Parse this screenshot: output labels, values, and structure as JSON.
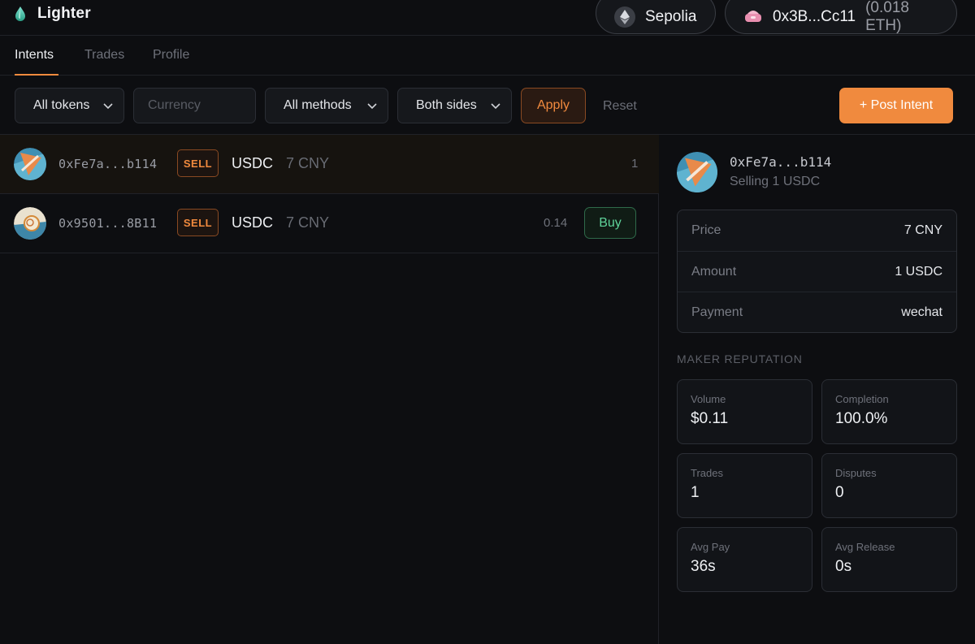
{
  "header": {
    "app_name": "Lighter",
    "network": "Sepolia",
    "wallet_address": "0x3B...Cc11",
    "wallet_balance": "(0.018 ETH)"
  },
  "tabs": [
    {
      "label": "Intents",
      "active": true
    },
    {
      "label": "Trades",
      "active": false
    },
    {
      "label": "Profile",
      "active": false
    }
  ],
  "filters": {
    "token_select": "All tokens",
    "currency_placeholder": "Currency",
    "method_select": "All methods",
    "side_select": "Both sides",
    "apply_label": "Apply",
    "reset_label": "Reset",
    "post_intent_label": "+ Post Intent"
  },
  "intents": [
    {
      "address": "0xFe7a...b114",
      "side": "SELL",
      "token": "USDC",
      "price": "7 CNY",
      "amount": "1",
      "action": ""
    },
    {
      "address": "0x9501...8B11",
      "side": "SELL",
      "token": "USDC",
      "price": "7 CNY",
      "amount": "0.14",
      "action": "Buy"
    }
  ],
  "detail": {
    "address": "0xFe7a...b114",
    "subtitle": "Selling 1 USDC",
    "info": [
      {
        "label": "Price",
        "value": "7 CNY"
      },
      {
        "label": "Amount",
        "value": "1 USDC"
      },
      {
        "label": "Payment",
        "value": "wechat"
      }
    ],
    "reputation_title": "MAKER REPUTATION",
    "stats": [
      {
        "label": "Volume",
        "value": "$0.11"
      },
      {
        "label": "Completion",
        "value": "100.0%"
      },
      {
        "label": "Trades",
        "value": "1"
      },
      {
        "label": "Disputes",
        "value": "0"
      },
      {
        "label": "Avg Pay",
        "value": "36s"
      },
      {
        "label": "Avg Release",
        "value": "0s"
      }
    ]
  },
  "colors": {
    "accent": "#f08a3e",
    "buy": "#5fd39a",
    "background": "#0d0e11"
  },
  "icons": [
    "droplet-logo-icon",
    "ethereum-icon",
    "wallet-icon",
    "chevron-down-icon"
  ]
}
